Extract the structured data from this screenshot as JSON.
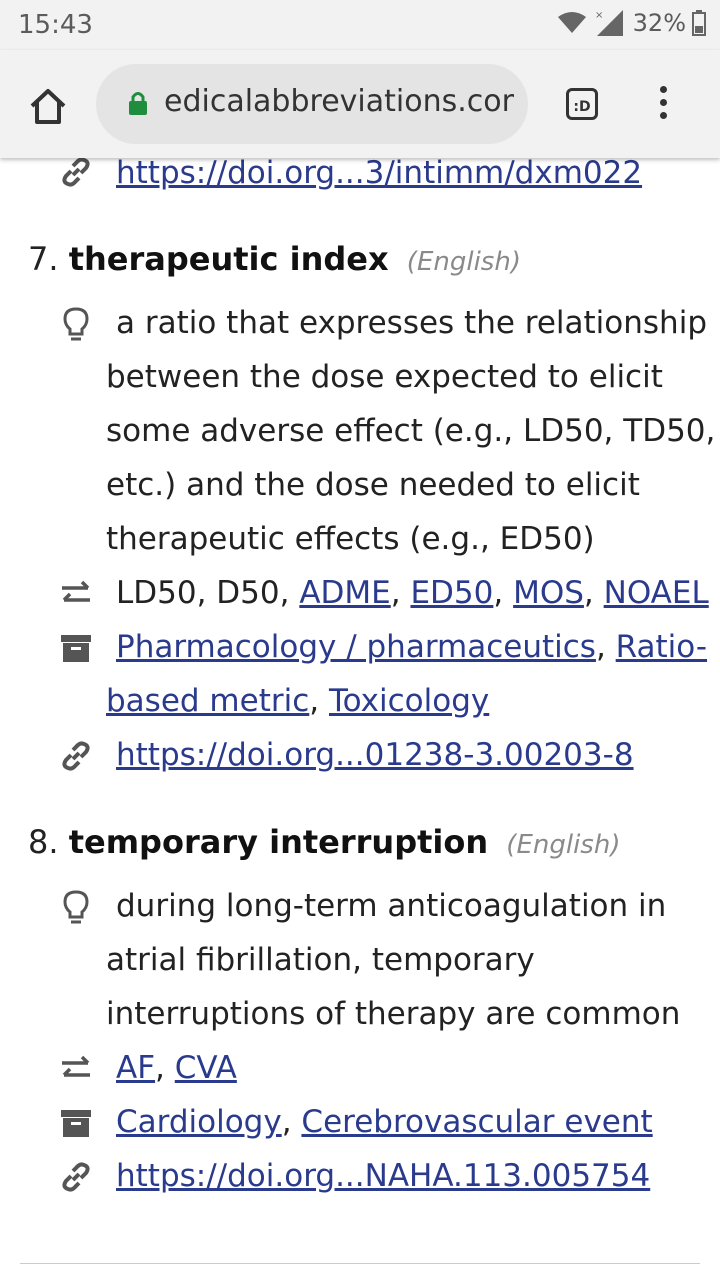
{
  "status_bar": {
    "time": "15:43",
    "battery": "32%"
  },
  "browser": {
    "url": "edicalabbreviations.com",
    "tab_label": ":D"
  },
  "prev_entry": {
    "link": "https://doi.org...3/intimm/dxm022"
  },
  "entries": [
    {
      "number": "7.",
      "term": "therapeutic index",
      "language": "(English)",
      "definition_lines": [
        "a ratio that expresses the relationship",
        "between the dose expected to elicit",
        "some adverse effect (e.g., LD50, TD50,",
        "etc.) and the dose needed to elicit",
        "therapeutic effects (e.g., ED50)"
      ],
      "related_plain": "LD50, D50,",
      "related_links": [
        "ADME",
        "ED50",
        "MOS",
        "NOAEL"
      ],
      "categories_line1": [
        "Pharmacology / pharmaceutics",
        "Ratio-"
      ],
      "categories_line2": [
        "based metric",
        "Toxicology"
      ],
      "link": "https://doi.org...01238-3.00203-8"
    },
    {
      "number": "8.",
      "term": "temporary interruption",
      "language": "(English)",
      "definition_lines": [
        "during long-term anticoagulation in",
        "atrial fibrillation, temporary",
        "interruptions of therapy are common"
      ],
      "related_links": [
        "AF",
        "CVA"
      ],
      "categories": [
        "Cardiology",
        "Cerebrovascular event"
      ],
      "link": "https://doi.org...NAHA.113.005754"
    }
  ],
  "icons": {
    "definition": "lightbulb-icon",
    "related": "swap-arrows-icon",
    "category": "archive-box-icon",
    "link": "link-icon"
  }
}
